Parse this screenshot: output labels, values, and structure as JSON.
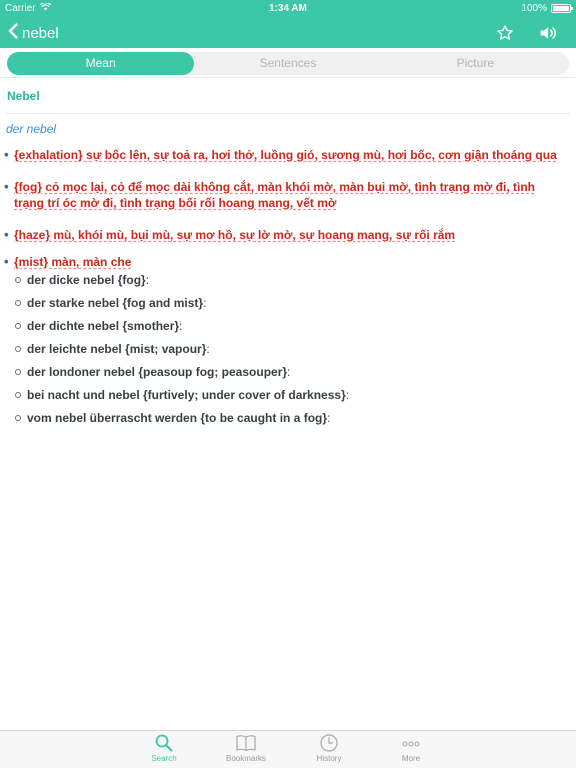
{
  "status": {
    "carrier": "Carrier",
    "time": "1:34 AM",
    "battery": "100%"
  },
  "nav": {
    "back_label": "nebel",
    "icons": [
      "chevron-left-icon",
      "star-icon",
      "speaker-icon"
    ]
  },
  "segments": {
    "items": [
      "Mean",
      "Sentences",
      "Picture"
    ],
    "selected": "Mean"
  },
  "entry": {
    "headword": "Nebel",
    "phrase": "der nebel",
    "definitions": [
      {
        "text": "{exhalation} sự bốc lên, sự toả ra, hơi thở, luồng gió, sương mù, hơi bốc, cơn giận thoáng qua",
        "examples": []
      },
      {
        "text": "{fog} cỏ mọc lại, cỏ để mọc dài không cắt, màn khói mờ, màn bụi mờ, tình trạng mờ đi, tình trạng trí óc mờ đi, tình trạng bối rối hoang mang, vết mờ",
        "examples": []
      },
      {
        "text": "{haze} mù, khói mù, bụi mù, sự mơ hồ, sự lờ mờ, sự hoang mang, sự rối rắm",
        "examples": []
      },
      {
        "text": "{mist} màn, màn che",
        "examples": [
          "der dicke nebel {fog}",
          "der starke nebel {fog and mist}",
          "der dichte nebel {smother}",
          "der leichte nebel {mist; vapour}",
          "der londoner nebel {peasoup fog; peasouper}",
          "bei nacht und nebel {furtively; under cover of darkness}",
          "vom nebel überrascht werden {to be caught in a fog}"
        ]
      }
    ]
  },
  "tabs": [
    {
      "label": "Search",
      "icon": "search-icon"
    },
    {
      "label": "Bookmarks",
      "icon": "book-icon"
    },
    {
      "label": "History",
      "icon": "clock-icon"
    },
    {
      "label": "More",
      "icon": "more-icon"
    }
  ],
  "selected_tab": "Search",
  "colors": {
    "accent": "#3cc7a6",
    "definition": "#d0261c",
    "phrase": "#3b8fe0"
  }
}
